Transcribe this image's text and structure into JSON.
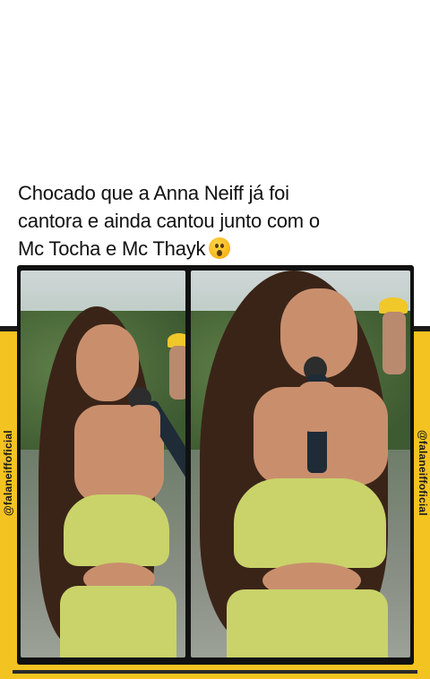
{
  "caption": {
    "line1": "Chocado que a Anna Neiff já foi",
    "line2": "cantora e ainda cantou junto com o",
    "line3": "Mc Tocha e Mc Thayk",
    "emoji": "astonished-face"
  },
  "watermark": {
    "left": "@falaneiffoficial",
    "right": "@falaneiffoficial"
  },
  "colors": {
    "frame": "#f3c321",
    "dress": "#c9d36a",
    "background": "#ffffff"
  }
}
